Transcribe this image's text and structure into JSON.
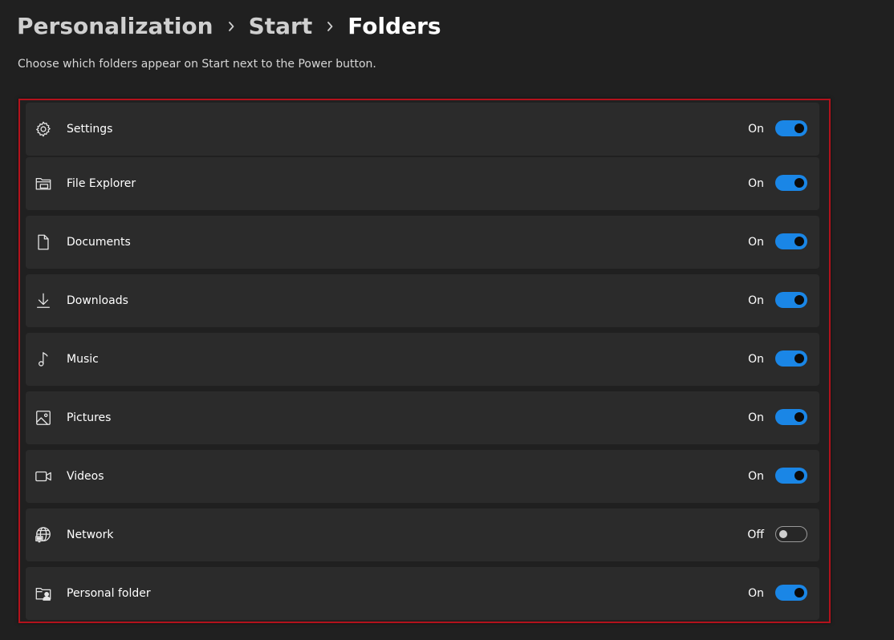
{
  "breadcrumb": {
    "items": [
      "Personalization",
      "Start",
      "Folders"
    ]
  },
  "subtitle": "Choose which folders appear on Start next to the Power button.",
  "accent_color": "#1a86e6",
  "highlight_color": "#b3121c",
  "folders": [
    {
      "label": "Settings",
      "state": "On",
      "icon": "gear-icon"
    },
    {
      "label": "File Explorer",
      "state": "On",
      "icon": "file-explorer-icon"
    },
    {
      "label": "Documents",
      "state": "On",
      "icon": "document-icon"
    },
    {
      "label": "Downloads",
      "state": "On",
      "icon": "download-icon"
    },
    {
      "label": "Music",
      "state": "On",
      "icon": "music-note-icon"
    },
    {
      "label": "Pictures",
      "state": "On",
      "icon": "picture-icon"
    },
    {
      "label": "Videos",
      "state": "On",
      "icon": "video-camera-icon"
    },
    {
      "label": "Network",
      "state": "Off",
      "icon": "network-globe-icon"
    },
    {
      "label": "Personal folder",
      "state": "On",
      "icon": "personal-folder-icon"
    }
  ]
}
